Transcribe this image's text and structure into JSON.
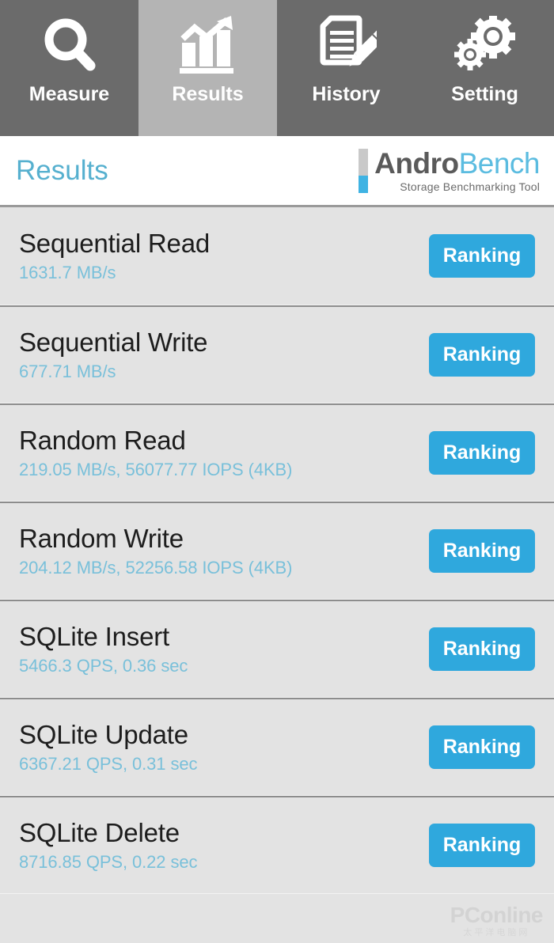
{
  "app": {
    "brand_primary": "Andro",
    "brand_secondary": "Bench",
    "brand_tagline": "Storage Benchmarking Tool",
    "accent_blue": "#2fa8dd",
    "title_blue": "#56b0cf",
    "value_blue": "#79c0da",
    "tab_bg": "#6b6b6b",
    "tab_active_bg": "#b4b4b4",
    "row_bg": "#e3e3e3"
  },
  "tabs": [
    {
      "label": "Measure",
      "icon": "magnifier-icon",
      "active": false
    },
    {
      "label": "Results",
      "icon": "bar-chart-arrow-icon",
      "active": true
    },
    {
      "label": "History",
      "icon": "document-pencil-icon",
      "active": false
    },
    {
      "label": "Setting",
      "icon": "gears-icon",
      "active": false
    }
  ],
  "header": {
    "title": "Results"
  },
  "results": [
    {
      "name": "Sequential Read",
      "value": "1631.7 MB/s",
      "button": "Ranking"
    },
    {
      "name": "Sequential Write",
      "value": "677.71 MB/s",
      "button": "Ranking"
    },
    {
      "name": "Random Read",
      "value": "219.05 MB/s, 56077.77 IOPS (4KB)",
      "button": "Ranking"
    },
    {
      "name": "Random Write",
      "value": "204.12 MB/s, 52256.58 IOPS (4KB)",
      "button": "Ranking"
    },
    {
      "name": "SQLite Insert",
      "value": "5466.3 QPS, 0.36 sec",
      "button": "Ranking"
    },
    {
      "name": "SQLite Update",
      "value": "6367.21 QPS, 0.31 sec",
      "button": "Ranking"
    },
    {
      "name": "SQLite Delete",
      "value": "8716.85 QPS, 0.22 sec",
      "button": "Ranking"
    }
  ],
  "watermark": {
    "main": "PConline",
    "sub": "太平洋电脑网"
  }
}
